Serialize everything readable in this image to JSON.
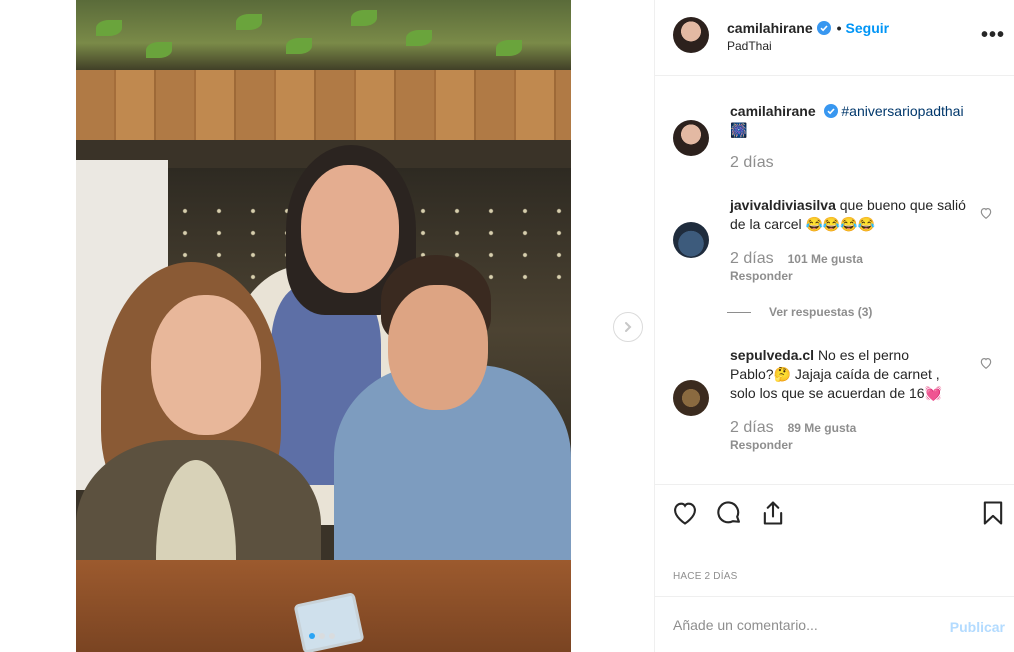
{
  "post": {
    "username": "camilahirane",
    "follow_label": "Seguir",
    "bullet": "•",
    "location": "PadThai",
    "more_label": "•••"
  },
  "caption": {
    "username": "camilahirane",
    "hashtag": "#aniversariopadthai",
    "emoji": "🎆",
    "time": "2 días"
  },
  "comments": [
    {
      "username": "javivaldiviasilva",
      "text": "que bueno que salió de la carcel 😂😂😂😂",
      "time": "2 días",
      "likes": "101 Me gusta",
      "reply_label": "Responder",
      "view_replies": "Ver respuestas (3)"
    },
    {
      "username": "sepulveda.cl",
      "text": "No es el perno Pablo?🤔 Jajaja caída de carnet , solo los que se acuerdan de 16💓",
      "time": "2 días",
      "likes": "89 Me gusta",
      "reply_label": "Responder"
    }
  ],
  "ago": "Hace 2 días",
  "add_comment": {
    "placeholder": "Añade un comentario...",
    "publish_label": "Publicar"
  },
  "colors": {
    "accent": "#0095f6",
    "link": "#00376b",
    "muted": "#8e8e8e",
    "publish_disabled": "#b3dbff"
  }
}
